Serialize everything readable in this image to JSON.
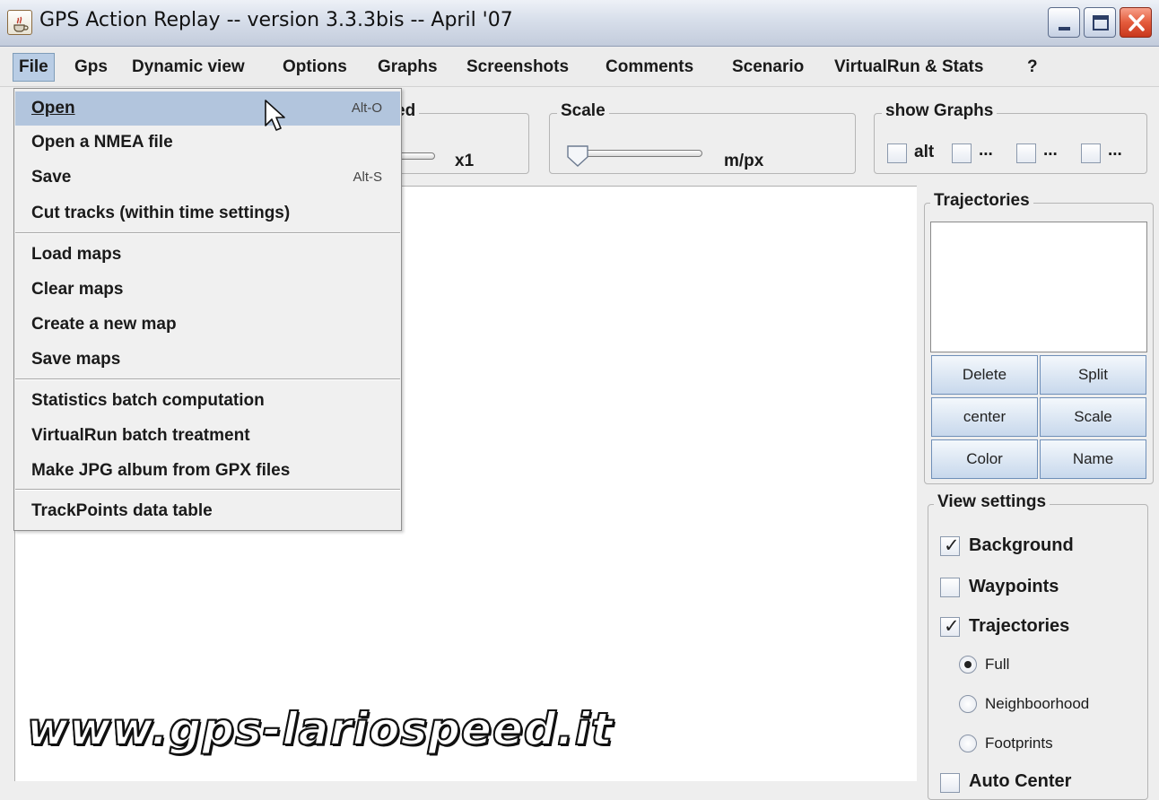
{
  "window": {
    "title": "GPS Action Replay -- version 3.3.3bis -- April '07",
    "icon": "java-cup-icon",
    "controls": [
      "minimize-icon",
      "maximize-icon",
      "close-icon"
    ]
  },
  "menubar": {
    "items": [
      {
        "label": "File",
        "active": true
      },
      {
        "label": "Gps"
      },
      {
        "label": "Dynamic view"
      },
      {
        "label": "Options"
      },
      {
        "label": "Graphs"
      },
      {
        "label": "Screenshots"
      },
      {
        "label": "Comments"
      },
      {
        "label": "Scenario"
      },
      {
        "label": "VirtualRun & Stats"
      },
      {
        "label": "?"
      }
    ]
  },
  "file_menu": {
    "groups": [
      [
        {
          "label": "Open",
          "mnemonic": "O",
          "accelerator": "Alt-O",
          "highlighted": true
        },
        {
          "label": "Open a NMEA file",
          "mnemonic": "O"
        },
        {
          "label": "Save",
          "mnemonic": "S",
          "accelerator": "Alt-S"
        },
        {
          "label": "Cut tracks (within time settings)"
        }
      ],
      [
        {
          "label": "Load maps"
        },
        {
          "label": "Clear maps"
        },
        {
          "label": "Create a new map"
        },
        {
          "label": "Save maps"
        }
      ],
      [
        {
          "label": "Statistics batch computation"
        },
        {
          "label": "VirtualRun batch treatment"
        },
        {
          "label": "Make JPG album from GPX files"
        }
      ],
      [
        {
          "label": "TrackPoints data table"
        }
      ]
    ]
  },
  "toolbar": {
    "speed": {
      "title_visible": "ed",
      "value_label": "x1"
    },
    "scale": {
      "title": "Scale",
      "unit_label": "m/px",
      "slider_level": 0.0
    },
    "show_graphs": {
      "title": "show Graphs",
      "options": [
        {
          "label": "alt",
          "checked": false
        },
        {
          "label": "...",
          "checked": false
        },
        {
          "label": "...",
          "checked": false
        },
        {
          "label": "...",
          "checked": false
        }
      ]
    }
  },
  "trajectories": {
    "title": "Trajectories",
    "items": [],
    "buttons": [
      [
        "Delete",
        "Split"
      ],
      [
        "center",
        "Scale"
      ],
      [
        "Color",
        "Name"
      ]
    ]
  },
  "view_settings": {
    "title": "View settings",
    "background": {
      "label": "Background",
      "checked": true
    },
    "waypoints": {
      "label": "Waypoints",
      "checked": false
    },
    "trajectories": {
      "label": "Trajectories",
      "checked": true
    },
    "modes": [
      {
        "label": "Full",
        "selected": true
      },
      {
        "label": "Neighboorhood",
        "selected": false
      },
      {
        "label": "Footprints",
        "selected": false
      }
    ],
    "auto_center": {
      "label": "Auto Center",
      "checked": false
    }
  },
  "watermark": "www.gps-lariospeed.it",
  "colors": {
    "menu_highlight": "#b2c5dd",
    "button_face": "#dbe6f3",
    "close_button": "#e45b3c"
  }
}
